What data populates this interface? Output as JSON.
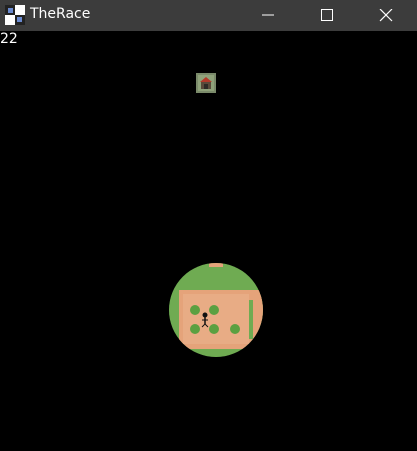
{
  "window": {
    "title": "TheRace",
    "icon": "app-icon",
    "controls": [
      "minimize-icon",
      "maximize-icon",
      "close-icon"
    ]
  },
  "hud": {
    "counter": "22"
  },
  "scene": {
    "background_color": "#000000",
    "grass_color": "#6aa84f",
    "path_color": "#e5a37a",
    "marker": "house-icon"
  }
}
